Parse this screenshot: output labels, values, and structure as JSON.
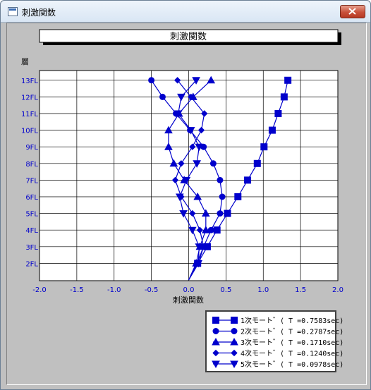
{
  "window": {
    "title": "刺激関数"
  },
  "chart_data": {
    "type": "line",
    "title": "刺激関数",
    "xlabel": "刺激関数",
    "ylabel": "層",
    "xlim": [
      -2.0,
      2.0
    ],
    "x_ticks": [
      "-2.0",
      "-1.5",
      "-1.0",
      "-0.5",
      "0.0",
      "0.5",
      "1.0",
      "1.5",
      "2.0"
    ],
    "y_categories": [
      "2FL",
      "3FL",
      "4FL",
      "5FL",
      "6FL",
      "7FL",
      "8FL",
      "9FL",
      "10FL",
      "11FL",
      "12FL",
      "13FL"
    ],
    "grid": true,
    "legend_position": "bottom-right",
    "line_color": "#0000cc",
    "series": [
      {
        "name": "1次モート゛( T =0.7583sec)",
        "marker": "square",
        "values": [
          0.0,
          0.12,
          0.25,
          0.38,
          0.52,
          0.66,
          0.79,
          0.92,
          1.01,
          1.12,
          1.2,
          1.28,
          1.33
        ]
      },
      {
        "name": "2次モート゛( T =0.2787sec)",
        "marker": "circle",
        "values": [
          0.0,
          0.11,
          0.2,
          0.3,
          0.42,
          0.45,
          0.42,
          0.33,
          0.2,
          0.02,
          -0.17,
          -0.35,
          -0.5
        ]
      },
      {
        "name": "3次モート゛( T =0.1710sec)",
        "marker": "triangle",
        "values": [
          0.0,
          0.1,
          0.15,
          0.23,
          0.23,
          0.12,
          -0.06,
          -0.2,
          -0.27,
          -0.27,
          -0.13,
          0.06,
          0.3
        ]
      },
      {
        "name": "4次モート゛( T =0.1240sec)",
        "marker": "diamond",
        "values": [
          0.0,
          0.13,
          0.2,
          0.15,
          0.05,
          -0.1,
          -0.18,
          -0.1,
          0.05,
          0.17,
          0.21,
          0.03,
          -0.15
        ]
      },
      {
        "name": "5次モート゛( T =0.0978sec)",
        "marker": "triangle-down",
        "values": [
          0.0,
          0.13,
          0.14,
          0.05,
          -0.07,
          -0.12,
          -0.03,
          0.11,
          0.14,
          0.03,
          -0.14,
          -0.1,
          0.1
        ]
      }
    ]
  }
}
